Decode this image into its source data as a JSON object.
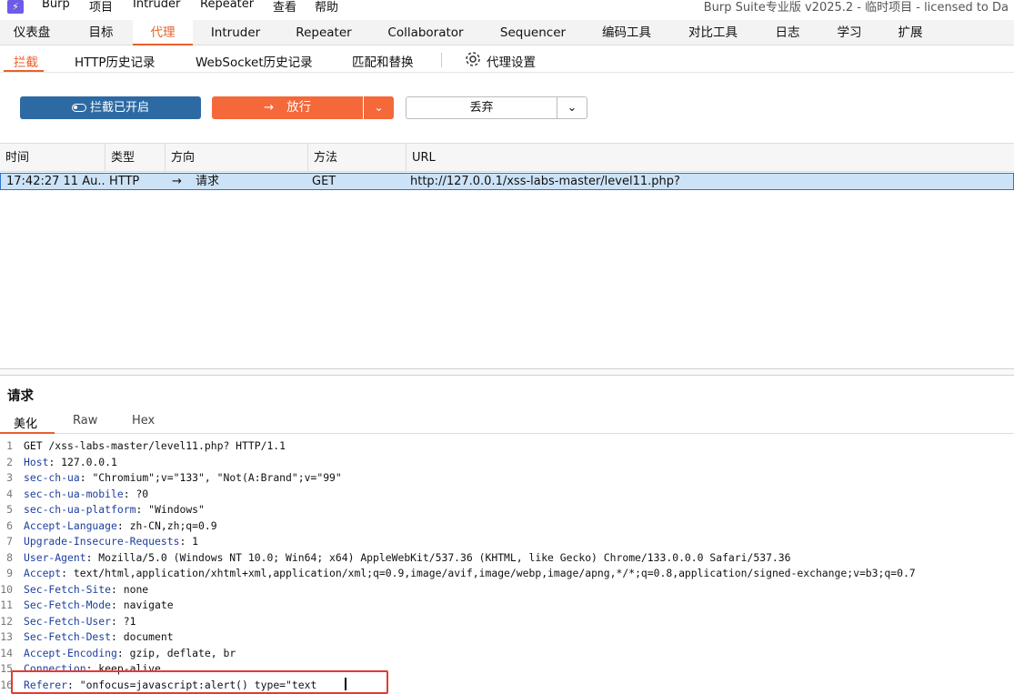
{
  "menubar": {
    "items": [
      "Burp",
      "项目",
      "Intruder",
      "Repeater",
      "查看",
      "帮助"
    ],
    "app_title": "Burp Suite专业版  v2025.2 - 临时项目 - licensed to Da"
  },
  "main_tabs": [
    "仪表盘",
    "目标",
    "代理",
    "Intruder",
    "Repeater",
    "Collaborator",
    "Sequencer",
    "编码工具",
    "对比工具",
    "日志",
    "学习",
    "扩展"
  ],
  "main_active_tab": "代理",
  "sub_tabs": [
    "拦截",
    "HTTP历史记录",
    "WebSocket历史记录",
    "匹配和替换"
  ],
  "proxy_settings_label": "代理设置",
  "toolbar": {
    "intercept_label": "拦截已开启",
    "forward_label": "放行",
    "drop_label": "丢弃"
  },
  "table": {
    "headers": [
      "时间",
      "类型",
      "方向",
      "方法",
      "URL"
    ],
    "row": {
      "time": "17:42:27 11 Au...",
      "type": "HTTP",
      "direction": "请求",
      "method": "GET",
      "url": "http://127.0.0.1/xss-labs-master/level11.php?"
    }
  },
  "request": {
    "title": "请求",
    "tabs": [
      "美化",
      "Raw",
      "Hex"
    ],
    "lines": [
      {
        "n": "1",
        "name": "",
        "value": "GET /xss-labs-master/level11.php? HTTP/1.1"
      },
      {
        "n": "2",
        "name": "Host",
        "value": " 127.0.0.1"
      },
      {
        "n": "3",
        "name": "sec-ch-ua",
        "value": " \"Chromium\";v=\"133\", \"Not(A:Brand\";v=\"99\""
      },
      {
        "n": "4",
        "name": "sec-ch-ua-mobile",
        "value": " ?0"
      },
      {
        "n": "5",
        "name": "sec-ch-ua-platform",
        "value": " \"Windows\""
      },
      {
        "n": "6",
        "name": "Accept-Language",
        "value": " zh-CN,zh;q=0.9"
      },
      {
        "n": "7",
        "name": "Upgrade-Insecure-Requests",
        "value": " 1"
      },
      {
        "n": "8",
        "name": "User-Agent",
        "value": " Mozilla/5.0 (Windows NT 10.0; Win64; x64) AppleWebKit/537.36 (KHTML, like Gecko) Chrome/133.0.0.0 Safari/537.36"
      },
      {
        "n": "9",
        "name": "Accept",
        "value": " text/html,application/xhtml+xml,application/xml;q=0.9,image/avif,image/webp,image/apng,*/*;q=0.8,application/signed-exchange;v=b3;q=0.7"
      },
      {
        "n": "10",
        "name": "Sec-Fetch-Site",
        "value": " none"
      },
      {
        "n": "11",
        "name": "Sec-Fetch-Mode",
        "value": " navigate"
      },
      {
        "n": "12",
        "name": "Sec-Fetch-User",
        "value": " ?1"
      },
      {
        "n": "13",
        "name": "Sec-Fetch-Dest",
        "value": " document"
      },
      {
        "n": "14",
        "name": "Accept-Encoding",
        "value": " gzip, deflate, br"
      },
      {
        "n": "15",
        "name": "Connection",
        "value": " keep-alive"
      },
      {
        "n": "16",
        "name": "Referer",
        "value": " \"onfocus=javascript:alert() type=\"text"
      }
    ]
  },
  "colors": {
    "accent": "#e8602c",
    "intercept_button": "#2d6aa3",
    "forward_button": "#f4683a",
    "selected_row": "#cce3f7",
    "header_name": "#1d3f9e",
    "highlight_box": "#e53935"
  }
}
